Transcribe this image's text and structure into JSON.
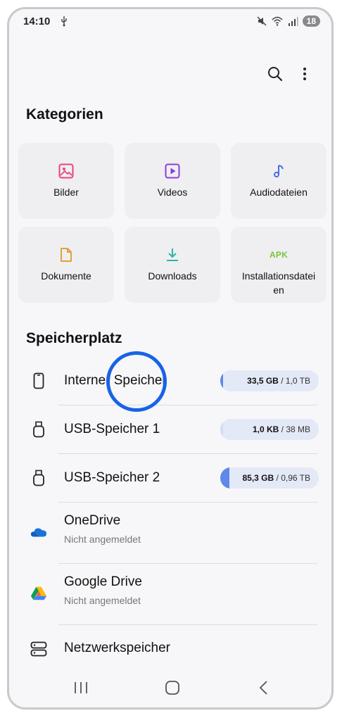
{
  "status_bar": {
    "time": "14:10",
    "battery": "18",
    "icons": [
      "usb-icon",
      "mute-icon",
      "wifi-icon",
      "signal-icon",
      "battery-icon"
    ]
  },
  "app_bar": {
    "actions": [
      "search-icon",
      "more-vert-icon"
    ]
  },
  "categories": {
    "title": "Kategorien",
    "items": [
      {
        "label": "Bilder",
        "icon": "image-icon",
        "color": "#e5457b"
      },
      {
        "label": "Videos",
        "icon": "video-icon",
        "color": "#8d3fd6"
      },
      {
        "label": "Audiodateien",
        "icon": "music-icon",
        "color": "#4a6ee0"
      },
      {
        "label": "Dokumente",
        "icon": "document-icon",
        "color": "#e0a23a"
      },
      {
        "label": "Downloads",
        "icon": "download-icon",
        "color": "#2bb5a0"
      },
      {
        "label": "Installationsdatei\nen",
        "icon": "apk-icon",
        "icon_text": "APK",
        "color": "#7bc33a"
      }
    ]
  },
  "storage": {
    "title": "Speicherplatz",
    "items": [
      {
        "title": "Interner Speicher",
        "icon": "phone-icon",
        "used": "33,5 GB",
        "total": " / 1,0 TB",
        "usage_fraction": 0.03
      },
      {
        "title": "USB-Speicher 1",
        "icon": "usb-drive-icon",
        "used": "1,0 KB",
        "total": " / 38 MB",
        "usage_fraction": 0.0
      },
      {
        "title": "USB-Speicher 2",
        "icon": "usb-drive-icon",
        "used": "85,3 GB",
        "total": " / 0,96 TB",
        "usage_fraction": 0.09
      },
      {
        "title": "OneDrive",
        "subtitle": "Nicht angemeldet",
        "icon": "onedrive-icon"
      },
      {
        "title": "Google Drive",
        "subtitle": "Nicht angemeldet",
        "icon": "google-drive-icon"
      },
      {
        "title": "Netzwerkspeicher",
        "icon": "network-storage-icon"
      }
    ]
  },
  "colors": {
    "accent": "#5f88e8",
    "pill_bg": "#e4e9f7",
    "touch_indicator": "#1863e6"
  },
  "nav_bar": {
    "buttons": [
      "recent-apps-icon",
      "home-icon",
      "back-icon"
    ]
  }
}
